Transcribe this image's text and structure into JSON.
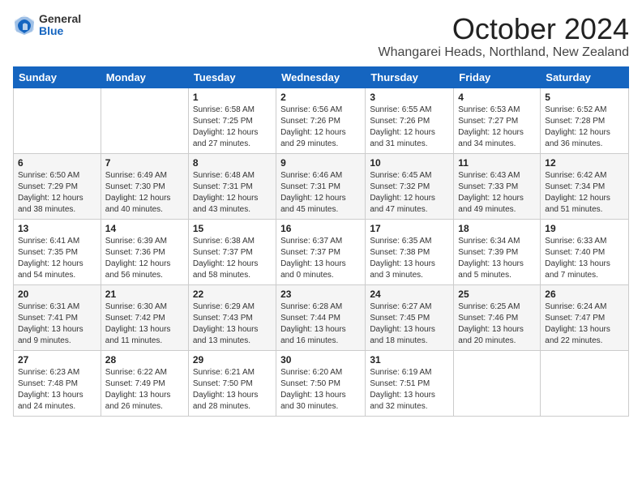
{
  "header": {
    "logo_general": "General",
    "logo_blue": "Blue",
    "month_title": "October 2024",
    "location": "Whangarei Heads, Northland, New Zealand"
  },
  "weekdays": [
    "Sunday",
    "Monday",
    "Tuesday",
    "Wednesday",
    "Thursday",
    "Friday",
    "Saturday"
  ],
  "weeks": [
    [
      {
        "day": "",
        "info": ""
      },
      {
        "day": "",
        "info": ""
      },
      {
        "day": "1",
        "info": "Sunrise: 6:58 AM\nSunset: 7:25 PM\nDaylight: 12 hours\nand 27 minutes."
      },
      {
        "day": "2",
        "info": "Sunrise: 6:56 AM\nSunset: 7:26 PM\nDaylight: 12 hours\nand 29 minutes."
      },
      {
        "day": "3",
        "info": "Sunrise: 6:55 AM\nSunset: 7:26 PM\nDaylight: 12 hours\nand 31 minutes."
      },
      {
        "day": "4",
        "info": "Sunrise: 6:53 AM\nSunset: 7:27 PM\nDaylight: 12 hours\nand 34 minutes."
      },
      {
        "day": "5",
        "info": "Sunrise: 6:52 AM\nSunset: 7:28 PM\nDaylight: 12 hours\nand 36 minutes."
      }
    ],
    [
      {
        "day": "6",
        "info": "Sunrise: 6:50 AM\nSunset: 7:29 PM\nDaylight: 12 hours\nand 38 minutes."
      },
      {
        "day": "7",
        "info": "Sunrise: 6:49 AM\nSunset: 7:30 PM\nDaylight: 12 hours\nand 40 minutes."
      },
      {
        "day": "8",
        "info": "Sunrise: 6:48 AM\nSunset: 7:31 PM\nDaylight: 12 hours\nand 43 minutes."
      },
      {
        "day": "9",
        "info": "Sunrise: 6:46 AM\nSunset: 7:31 PM\nDaylight: 12 hours\nand 45 minutes."
      },
      {
        "day": "10",
        "info": "Sunrise: 6:45 AM\nSunset: 7:32 PM\nDaylight: 12 hours\nand 47 minutes."
      },
      {
        "day": "11",
        "info": "Sunrise: 6:43 AM\nSunset: 7:33 PM\nDaylight: 12 hours\nand 49 minutes."
      },
      {
        "day": "12",
        "info": "Sunrise: 6:42 AM\nSunset: 7:34 PM\nDaylight: 12 hours\nand 51 minutes."
      }
    ],
    [
      {
        "day": "13",
        "info": "Sunrise: 6:41 AM\nSunset: 7:35 PM\nDaylight: 12 hours\nand 54 minutes."
      },
      {
        "day": "14",
        "info": "Sunrise: 6:39 AM\nSunset: 7:36 PM\nDaylight: 12 hours\nand 56 minutes."
      },
      {
        "day": "15",
        "info": "Sunrise: 6:38 AM\nSunset: 7:37 PM\nDaylight: 12 hours\nand 58 minutes."
      },
      {
        "day": "16",
        "info": "Sunrise: 6:37 AM\nSunset: 7:37 PM\nDaylight: 13 hours\nand 0 minutes."
      },
      {
        "day": "17",
        "info": "Sunrise: 6:35 AM\nSunset: 7:38 PM\nDaylight: 13 hours\nand 3 minutes."
      },
      {
        "day": "18",
        "info": "Sunrise: 6:34 AM\nSunset: 7:39 PM\nDaylight: 13 hours\nand 5 minutes."
      },
      {
        "day": "19",
        "info": "Sunrise: 6:33 AM\nSunset: 7:40 PM\nDaylight: 13 hours\nand 7 minutes."
      }
    ],
    [
      {
        "day": "20",
        "info": "Sunrise: 6:31 AM\nSunset: 7:41 PM\nDaylight: 13 hours\nand 9 minutes."
      },
      {
        "day": "21",
        "info": "Sunrise: 6:30 AM\nSunset: 7:42 PM\nDaylight: 13 hours\nand 11 minutes."
      },
      {
        "day": "22",
        "info": "Sunrise: 6:29 AM\nSunset: 7:43 PM\nDaylight: 13 hours\nand 13 minutes."
      },
      {
        "day": "23",
        "info": "Sunrise: 6:28 AM\nSunset: 7:44 PM\nDaylight: 13 hours\nand 16 minutes."
      },
      {
        "day": "24",
        "info": "Sunrise: 6:27 AM\nSunset: 7:45 PM\nDaylight: 13 hours\nand 18 minutes."
      },
      {
        "day": "25",
        "info": "Sunrise: 6:25 AM\nSunset: 7:46 PM\nDaylight: 13 hours\nand 20 minutes."
      },
      {
        "day": "26",
        "info": "Sunrise: 6:24 AM\nSunset: 7:47 PM\nDaylight: 13 hours\nand 22 minutes."
      }
    ],
    [
      {
        "day": "27",
        "info": "Sunrise: 6:23 AM\nSunset: 7:48 PM\nDaylight: 13 hours\nand 24 minutes."
      },
      {
        "day": "28",
        "info": "Sunrise: 6:22 AM\nSunset: 7:49 PM\nDaylight: 13 hours\nand 26 minutes."
      },
      {
        "day": "29",
        "info": "Sunrise: 6:21 AM\nSunset: 7:50 PM\nDaylight: 13 hours\nand 28 minutes."
      },
      {
        "day": "30",
        "info": "Sunrise: 6:20 AM\nSunset: 7:50 PM\nDaylight: 13 hours\nand 30 minutes."
      },
      {
        "day": "31",
        "info": "Sunrise: 6:19 AM\nSunset: 7:51 PM\nDaylight: 13 hours\nand 32 minutes."
      },
      {
        "day": "",
        "info": ""
      },
      {
        "day": "",
        "info": ""
      }
    ]
  ]
}
